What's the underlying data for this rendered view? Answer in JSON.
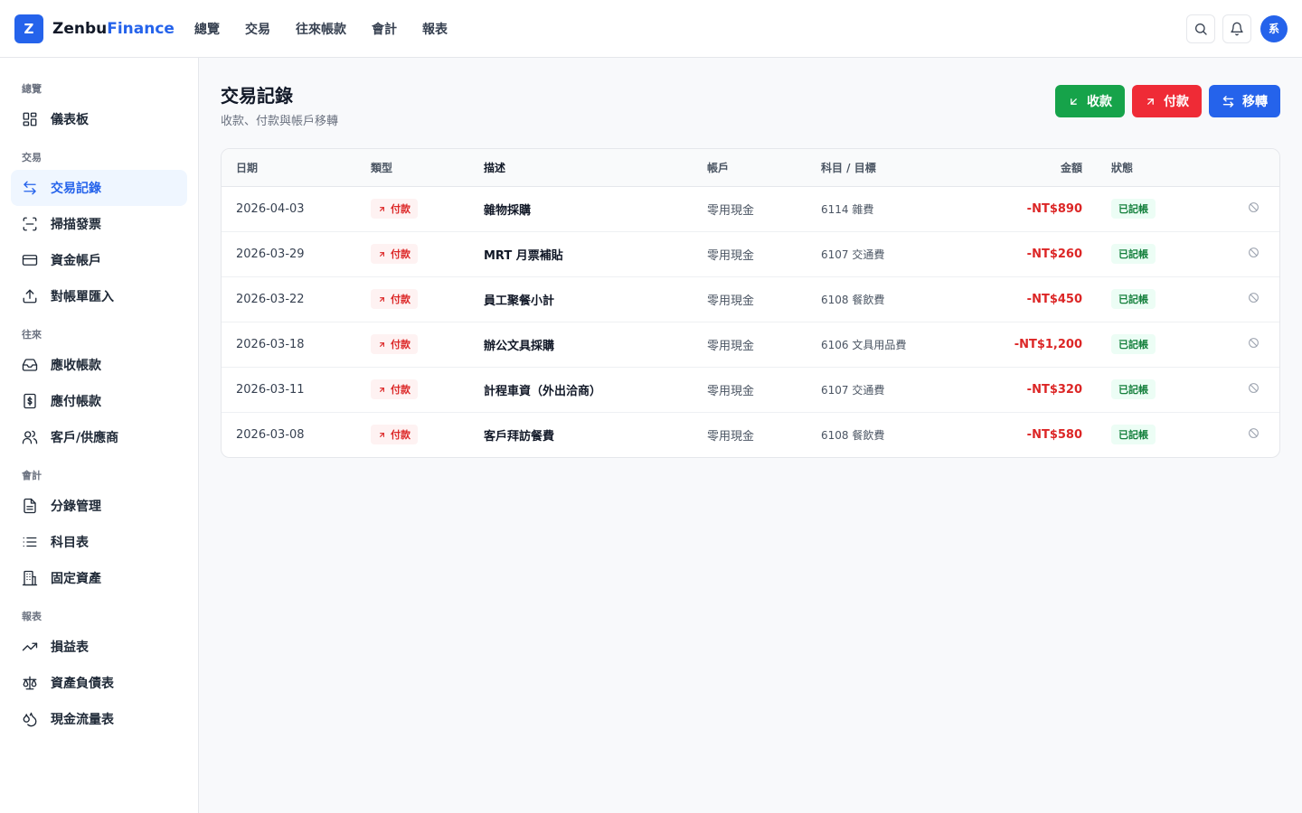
{
  "brand": {
    "logo_letter": "Z",
    "name_part1": "Zenbu",
    "name_part2": "Finance"
  },
  "topnav": [
    "總覽",
    "交易",
    "往來帳款",
    "會計",
    "報表"
  ],
  "user": {
    "avatar": "系"
  },
  "sidebar": {
    "sections": [
      {
        "label": "總覽",
        "items": [
          {
            "label": "儀表板",
            "icon": "grid-icon"
          }
        ]
      },
      {
        "label": "交易",
        "items": [
          {
            "label": "交易記錄",
            "icon": "transfer-icon",
            "active": true
          },
          {
            "label": "掃描發票",
            "icon": "scan-icon"
          },
          {
            "label": "資金帳戶",
            "icon": "card-icon"
          },
          {
            "label": "對帳單匯入",
            "icon": "upload-icon"
          }
        ]
      },
      {
        "label": "往來",
        "items": [
          {
            "label": "應收帳款",
            "icon": "inbox-icon"
          },
          {
            "label": "應付帳款",
            "icon": "dollar-doc-icon"
          },
          {
            "label": "客戶/供應商",
            "icon": "users-icon"
          }
        ]
      },
      {
        "label": "會計",
        "items": [
          {
            "label": "分錄管理",
            "icon": "document-icon"
          },
          {
            "label": "科目表",
            "icon": "list-icon"
          },
          {
            "label": "固定資產",
            "icon": "building-icon"
          }
        ]
      },
      {
        "label": "報表",
        "items": [
          {
            "label": "損益表",
            "icon": "trend-up-icon"
          },
          {
            "label": "資產負債表",
            "icon": "scale-icon"
          },
          {
            "label": "現金流量表",
            "icon": "droplets-icon"
          }
        ]
      }
    ]
  },
  "page": {
    "title": "交易記錄",
    "subtitle": "收款、付款與帳戶移轉",
    "actions": {
      "receive": "收款",
      "pay": "付款",
      "transfer": "移轉"
    }
  },
  "colors": {
    "accent": "#2563eb",
    "receive": "#16a34a",
    "pay": "#ef2b36",
    "negative": "#dc2626",
    "posted": "#15803d"
  },
  "table": {
    "headers": {
      "date": "日期",
      "type": "類型",
      "desc": "描述",
      "account": "帳戶",
      "category": "科目 / 目標",
      "amount": "金額",
      "status": "狀態"
    },
    "rows": [
      {
        "date": "2026-04-03",
        "type": "付款",
        "desc": "雜物採購",
        "account": "零用現金",
        "category": "6114 雜費",
        "amount": "-NT$890",
        "status": "已記帳"
      },
      {
        "date": "2026-03-29",
        "type": "付款",
        "desc": "MRT 月票補貼",
        "account": "零用現金",
        "category": "6107 交通費",
        "amount": "-NT$260",
        "status": "已記帳"
      },
      {
        "date": "2026-03-22",
        "type": "付款",
        "desc": "員工聚餐小計",
        "account": "零用現金",
        "category": "6108 餐飲費",
        "amount": "-NT$450",
        "status": "已記帳"
      },
      {
        "date": "2026-03-18",
        "type": "付款",
        "desc": "辦公文具採購",
        "account": "零用現金",
        "category": "6106 文具用品費",
        "amount": "-NT$1,200",
        "status": "已記帳"
      },
      {
        "date": "2026-03-11",
        "type": "付款",
        "desc": "計程車資（外出洽商）",
        "account": "零用現金",
        "category": "6107 交通費",
        "amount": "-NT$320",
        "status": "已記帳"
      },
      {
        "date": "2026-03-08",
        "type": "付款",
        "desc": "客戶拜訪餐費",
        "account": "零用現金",
        "category": "6108 餐飲費",
        "amount": "-NT$580",
        "status": "已記帳"
      }
    ]
  }
}
